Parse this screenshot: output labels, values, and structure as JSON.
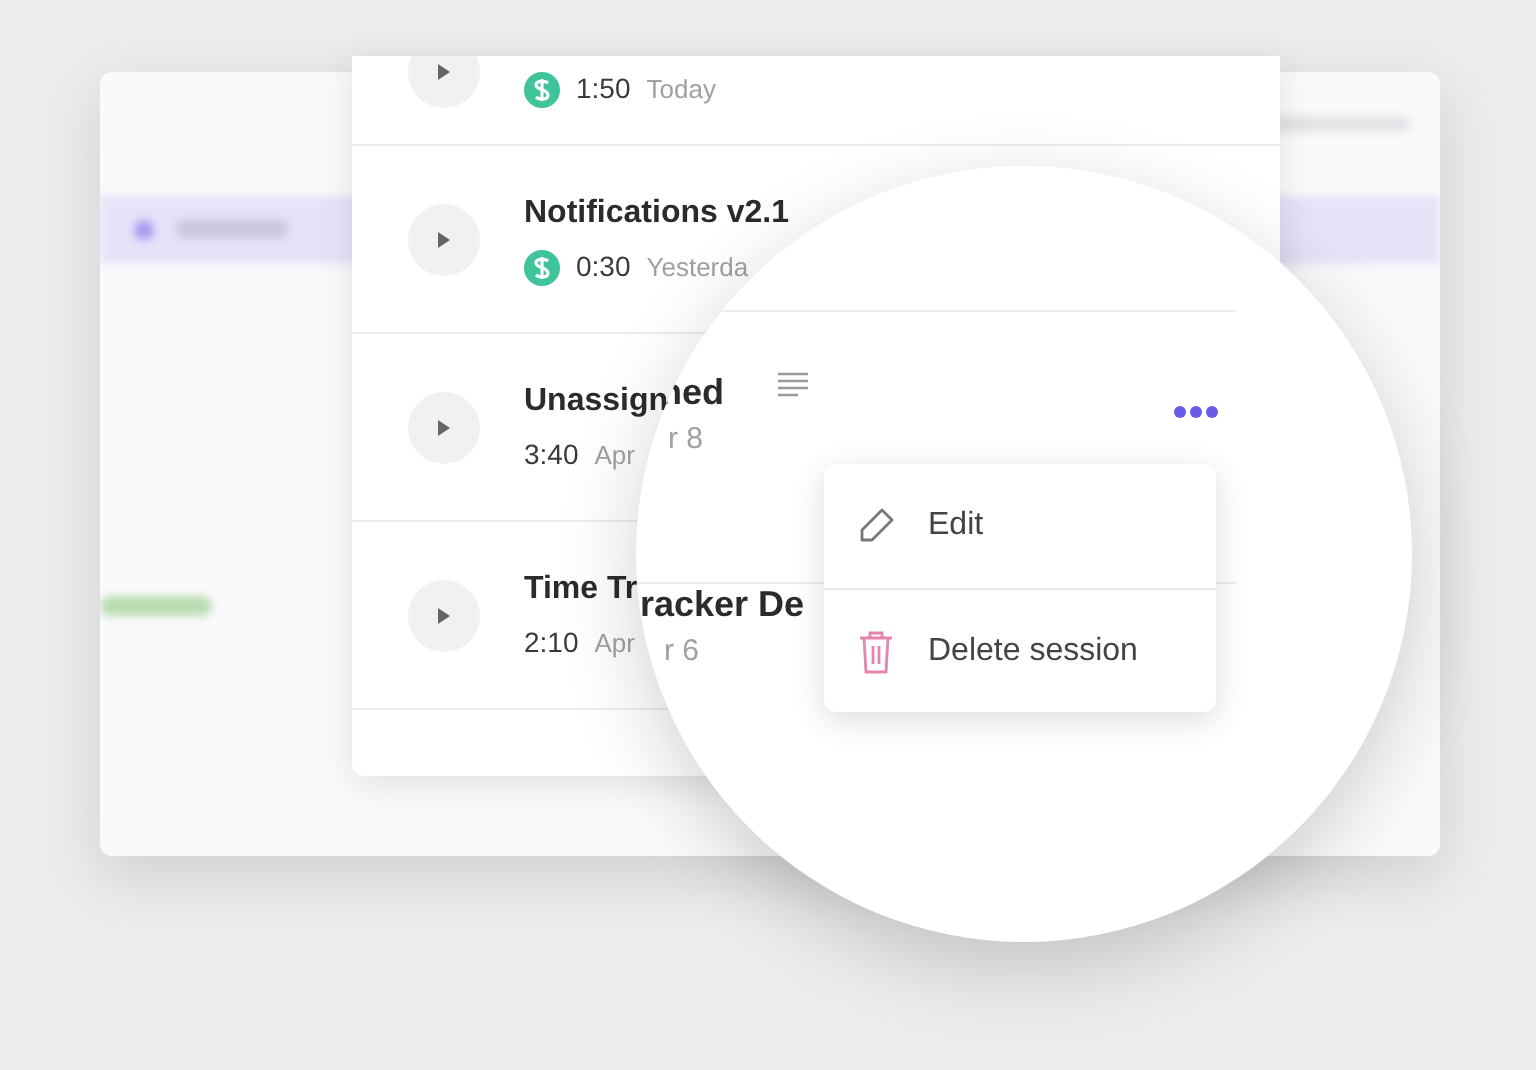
{
  "sessions": [
    {
      "billable": true,
      "duration": "1:50",
      "date": "Today"
    },
    {
      "title": "Notifications v2.1",
      "billable": true,
      "duration": "0:30",
      "date": "Yesterda"
    },
    {
      "title": "Unassign",
      "billable": false,
      "duration": "3:40",
      "date": "Apr"
    },
    {
      "title": "Time Tr",
      "billable": false,
      "duration": "2:10",
      "date": "Apr"
    }
  ],
  "magnifier": {
    "fragments": [
      {
        "kind": "title",
        "text": "ned"
      },
      {
        "kind": "date",
        "text": "r 8"
      },
      {
        "kind": "title",
        "text": "racker De"
      },
      {
        "kind": "date",
        "text": "r 6"
      }
    ],
    "menu": [
      {
        "kind": "edit",
        "label": "Edit"
      },
      {
        "kind": "delete",
        "label": "Delete session"
      }
    ]
  }
}
